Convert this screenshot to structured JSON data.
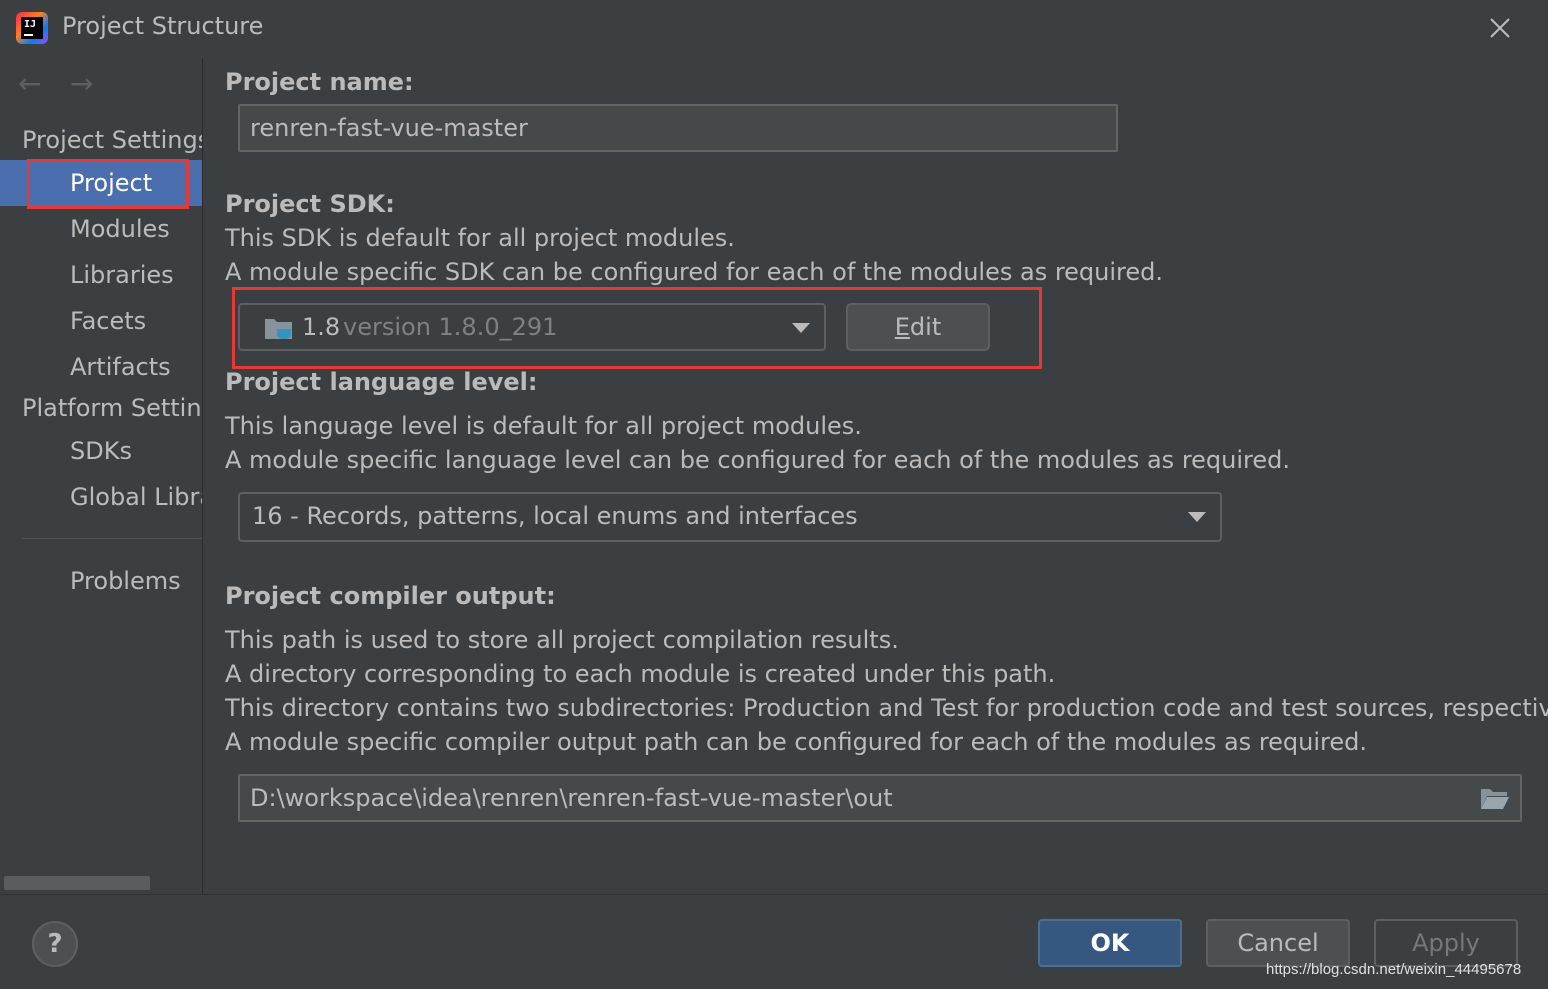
{
  "window": {
    "title": "Project Structure",
    "logo_text": "IJ"
  },
  "sidebar": {
    "groups": {
      "project_settings": "Project Settings",
      "platform_settings": "Platform Settings"
    },
    "items": [
      {
        "label": "Project"
      },
      {
        "label": "Modules"
      },
      {
        "label": "Libraries"
      },
      {
        "label": "Facets"
      },
      {
        "label": "Artifacts"
      },
      {
        "label": "SDKs"
      },
      {
        "label": "Global Libraries"
      },
      {
        "label": "Problems"
      }
    ],
    "back_glyph": "←",
    "forward_glyph": "→"
  },
  "project_name": {
    "label": "Project name:",
    "value": "renren-fast-vue-master"
  },
  "project_sdk": {
    "label": "Project SDK:",
    "desc1": "This SDK is default for all project modules.",
    "desc2": "A module specific SDK can be configured for each of the modules as required.",
    "selected_name": "1.8",
    "selected_version": "version 1.8.0_291",
    "edit_mnemonic": "E",
    "edit_rest": "dit"
  },
  "language_level": {
    "label": "Project language level:",
    "desc1": "This language level is default for all project modules.",
    "desc2": "A module specific language level can be configured for each of the modules as required.",
    "selected": "16 - Records, patterns, local enums and interfaces"
  },
  "compiler_output": {
    "label": "Project compiler output:",
    "desc1": "This path is used to store all project compilation results.",
    "desc2": "A directory corresponding to each module is created under this path.",
    "desc3": "This directory contains two subdirectories: Production and Test for production code and test sources, respectively.",
    "desc4": "A module specific compiler output path can be configured for each of the modules as required.",
    "path": "D:\\workspace\\idea\\renren\\renren-fast-vue-master\\out"
  },
  "footer": {
    "help": "?",
    "ok": "OK",
    "cancel": "Cancel",
    "apply": "Apply",
    "watermark": "https://blog.csdn.net/weixin_44495678"
  },
  "colors": {
    "background": "#3c3f41",
    "selection": "#4b6eaf",
    "highlight_box": "#e53935",
    "ok_button": "#365880"
  },
  "icons": [
    "intellij-logo-icon",
    "close-icon",
    "back-arrow-icon",
    "forward-arrow-icon",
    "jdk-folder-icon",
    "chevron-down-icon",
    "folder-open-icon",
    "help-icon"
  ]
}
